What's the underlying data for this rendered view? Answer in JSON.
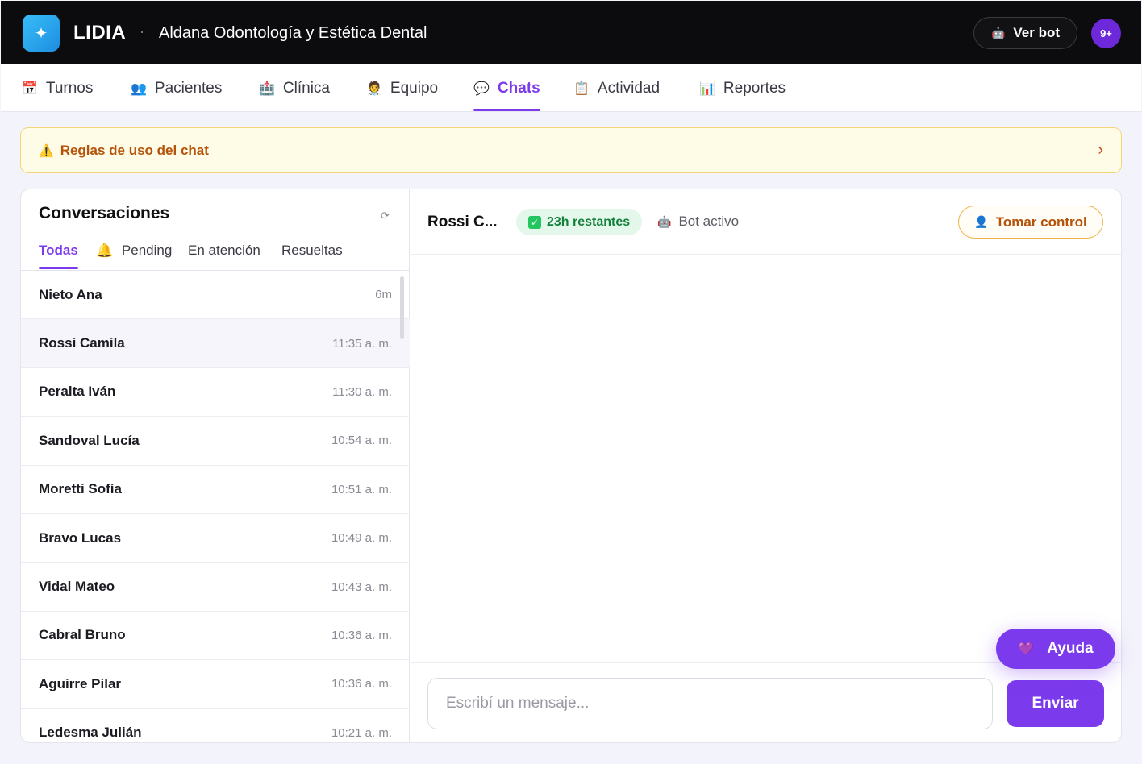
{
  "app": {
    "brand": "LIDIA",
    "separator": "·",
    "clinic_name": "Aldana Odontología y Estética Dental",
    "ver_bot_label": "Ver bot",
    "notifications_badge": "9+"
  },
  "nav": {
    "items": [
      {
        "icon": "📅",
        "label": "Turnos"
      },
      {
        "icon": "👥",
        "label": "Pacientes"
      },
      {
        "icon": "🏥",
        "label": "Clínica"
      },
      {
        "icon": "🧑‍⚕️",
        "label": "Equipo"
      },
      {
        "icon": "💬",
        "label": "Chats"
      },
      {
        "icon": "📋",
        "label": "Actividad"
      },
      {
        "icon": "📊",
        "label": "Reportes"
      }
    ],
    "active": "Chats"
  },
  "rules_banner": {
    "label": "Reglas de uso del chat"
  },
  "conversations": {
    "title": "Conversaciones",
    "filters": [
      {
        "label": "Todas"
      },
      {
        "label": "Pending"
      },
      {
        "label": "En atención"
      },
      {
        "label": "Resueltas"
      }
    ],
    "active_filter": "Todas",
    "items": [
      {
        "name": "Nieto Ana",
        "time": "6m"
      },
      {
        "name": "Rossi Camila",
        "time": "11:35 a. m."
      },
      {
        "name": "Peralta Iván",
        "time": "11:30 a. m."
      },
      {
        "name": "Sandoval Lucía",
        "time": "10:54 a. m."
      },
      {
        "name": "Moretti Sofía",
        "time": "10:51 a. m."
      },
      {
        "name": "Bravo Lucas",
        "time": "10:49 a. m."
      },
      {
        "name": "Vidal Mateo",
        "time": "10:43 a. m."
      },
      {
        "name": "Cabral Bruno",
        "time": "10:36 a. m."
      },
      {
        "name": "Aguirre Pilar",
        "time": "10:36 a. m."
      },
      {
        "name": "Ledesma Julián",
        "time": "10:21 a. m."
      }
    ],
    "selected": "Rossi Camila"
  },
  "chat": {
    "contact_name": "Rossi C...",
    "window_badge": "23h restantes",
    "bot_status": "Bot activo",
    "take_control_label": "Tomar control",
    "message_placeholder": "Escribí un mensaje...",
    "send_label": "Enviar"
  },
  "help": {
    "label": "Ayuda"
  }
}
